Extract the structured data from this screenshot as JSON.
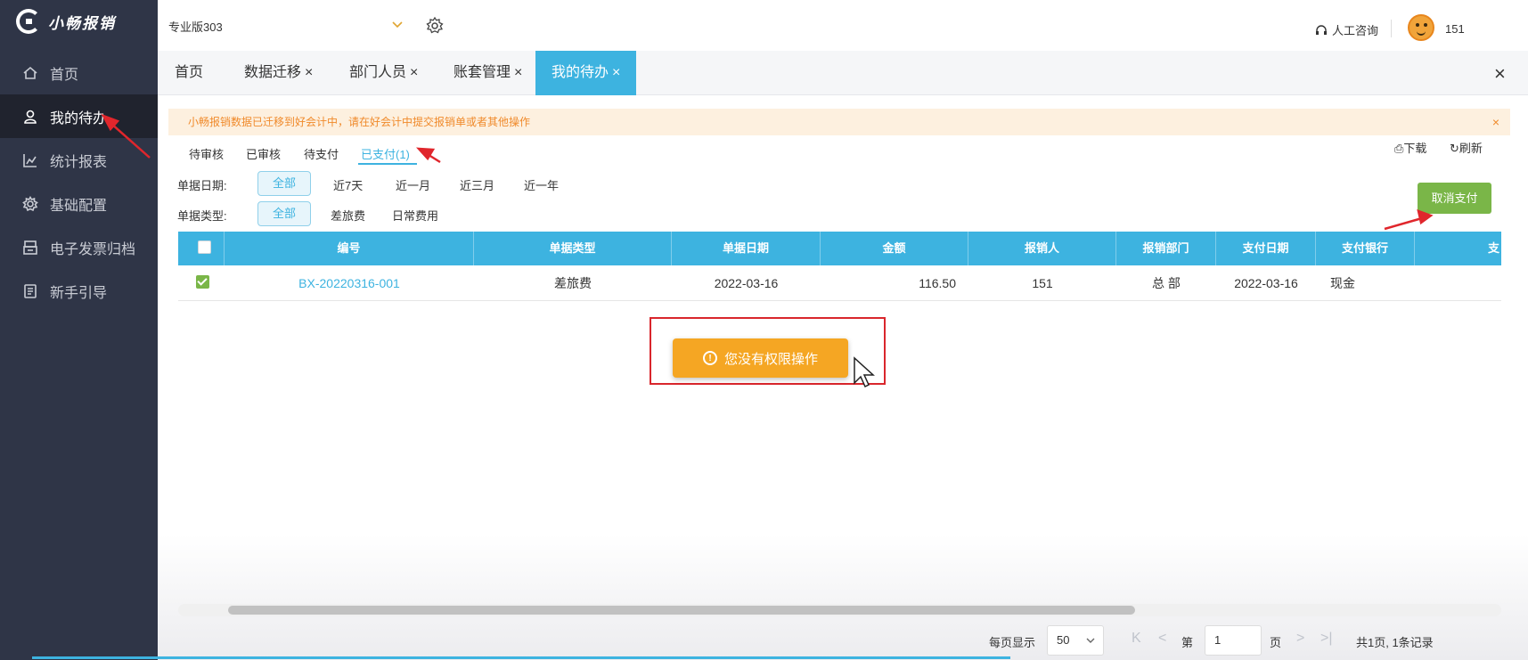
{
  "app": {
    "logo_text": "小畅报销"
  },
  "sidebar": {
    "items": [
      {
        "label": "首页",
        "icon": "home-icon"
      },
      {
        "label": "我的待办",
        "icon": "user-task-icon",
        "active": true
      },
      {
        "label": "统计报表",
        "icon": "chart-icon"
      },
      {
        "label": "基础配置",
        "icon": "gear-icon"
      },
      {
        "label": "电子发票归档",
        "icon": "archive-icon"
      },
      {
        "label": "新手引导",
        "icon": "guide-icon"
      }
    ]
  },
  "header": {
    "version": "专业版303",
    "consult": "人工咨询",
    "user": "151"
  },
  "tabs": [
    {
      "label": "首页",
      "closable": false
    },
    {
      "label": "数据迁移",
      "closable": true
    },
    {
      "label": "部门人员",
      "closable": true
    },
    {
      "label": "账套管理",
      "closable": true
    },
    {
      "label": "我的待办",
      "closable": true,
      "active": true
    }
  ],
  "tab_close_glyph": "×",
  "notice": {
    "text": "小畅报销数据已迁移到好会计中，请在好会计中提交报销单或者其他操作",
    "close": "×"
  },
  "status_tabs": [
    "待审核",
    "已审核",
    "待支付",
    "已支付(1)"
  ],
  "tools": {
    "download": "下载",
    "refresh": "刷新"
  },
  "filters": {
    "date_label": "单据日期:",
    "date_options": [
      "全部",
      "近7天",
      "近一月",
      "近三月",
      "近一年"
    ],
    "type_label": "单据类型:",
    "type_options": [
      "全部",
      "差旅费",
      "日常费用"
    ]
  },
  "actions": {
    "cancel_pay": "取消支付"
  },
  "table": {
    "columns": [
      "编号",
      "单据类型",
      "单据日期",
      "金额",
      "报销人",
      "报销部门",
      "支付日期",
      "支付银行",
      "支"
    ],
    "rows": [
      {
        "id": "BX-20220316-001",
        "type": "差旅费",
        "date": "2022-03-16",
        "amount": "116.50",
        "person": "151",
        "dept": "总 部",
        "pay_date": "2022-03-16",
        "bank": "现金"
      }
    ]
  },
  "toast": {
    "message": "您没有权限操作",
    "icon_glyph": "!"
  },
  "pagination": {
    "per_page_label": "每页显示",
    "per_page": "50",
    "page_prefix": "第",
    "page": "1",
    "page_suffix": "页",
    "summary": "共1页, 1条记录",
    "first": "K",
    "prev": "<",
    "next": ">",
    "last": ">|"
  },
  "colors": {
    "sidebar_bg": "#2f3547",
    "accent": "#3db3e0",
    "toast_bg": "#f5a623",
    "cancel_pay_bg": "#7ab648",
    "annotation_red": "#d9262c"
  }
}
